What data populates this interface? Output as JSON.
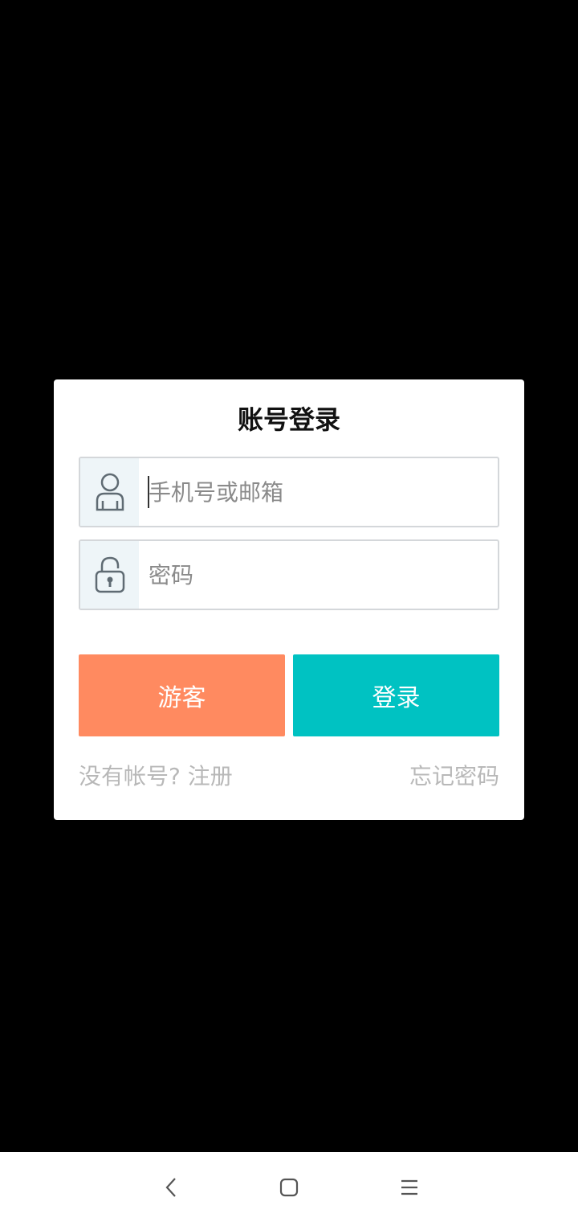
{
  "dialog": {
    "title": "账号登录",
    "username": {
      "placeholder": "手机号或邮箱",
      "value": "",
      "icon": "user-icon"
    },
    "password": {
      "placeholder": "密码",
      "value": "",
      "icon": "lock-icon"
    },
    "guest_button": "游客",
    "login_button": "登录",
    "register_link": "没有帐号? 注册",
    "forgot_link": "忘记密码"
  },
  "colors": {
    "guest": "#ff8a60",
    "login": "#00c2c2",
    "icon_bg": "#eef5f8",
    "link": "#b8b8b8"
  },
  "navbar": {
    "buttons": [
      "back-icon",
      "home-icon",
      "menu-icon"
    ]
  }
}
